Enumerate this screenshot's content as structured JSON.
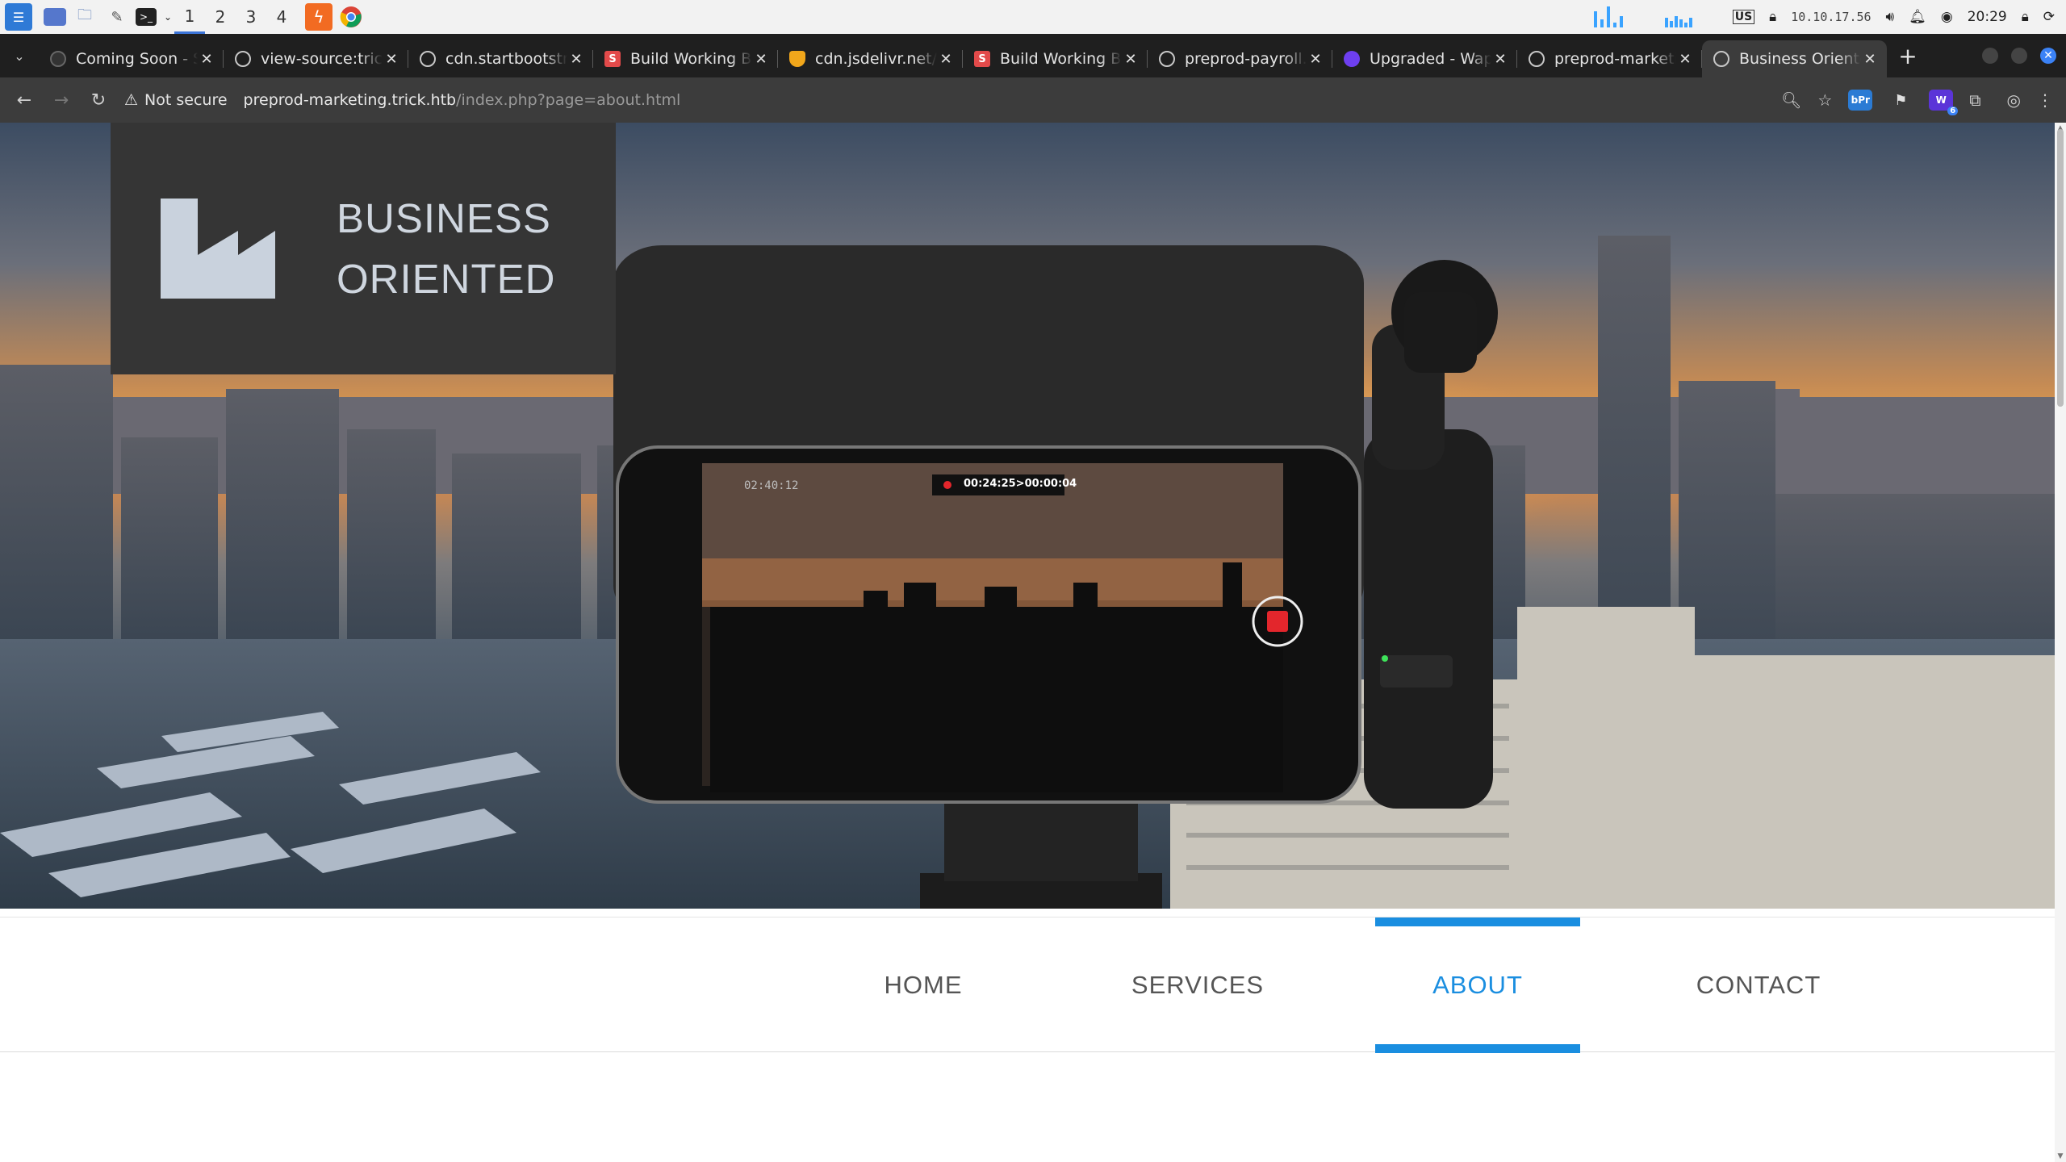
{
  "os_panel": {
    "workspaces": [
      "1",
      "2",
      "3",
      "4"
    ],
    "active_workspace": "1",
    "keyboard_layout": "US",
    "ip_address": "10.10.17.56",
    "clock": "20:29"
  },
  "tabs": [
    {
      "title": "Coming Soon - Single Page",
      "favicon": "dark-globe-icon"
    },
    {
      "title": "view-source:trick.htb",
      "favicon": "globe-icon"
    },
    {
      "title": "cdn.startbootstrap.com",
      "favicon": "globe-icon"
    },
    {
      "title": "Build Working Bootstrap",
      "favicon": "s-icon"
    },
    {
      "title": "cdn.jsdelivr.net/npm",
      "favicon": "shield-icon"
    },
    {
      "title": "Build Working Bootstrap",
      "favicon": "s-icon"
    },
    {
      "title": "preprod-payroll.trick.htb",
      "favicon": "globe-icon"
    },
    {
      "title": "Upgraded - Wappalyzer",
      "favicon": "wappalyzer-icon"
    },
    {
      "title": "preprod-marketing.trick.htb",
      "favicon": "globe-icon"
    },
    {
      "title": "Business Oriented",
      "favicon": "globe-icon",
      "active": true
    }
  ],
  "toolbar": {
    "security_label": "Not secure",
    "url_host": "preprod-marketing.trick.htb",
    "url_path": "/index.php?page=about.html",
    "extension_badge": "6"
  },
  "page": {
    "brand_line1": "BUSINESS",
    "brand_line2": "ORIENTED",
    "phone_battery": "02:40:12",
    "phone_timer": "00:24:25>00:00:04",
    "nav": [
      {
        "label": "HOME",
        "active": false
      },
      {
        "label": "SERVICES",
        "active": false
      },
      {
        "label": "ABOUT",
        "active": true
      },
      {
        "label": "CONTACT",
        "active": false
      }
    ],
    "accent_color": "#1a8ee0"
  }
}
